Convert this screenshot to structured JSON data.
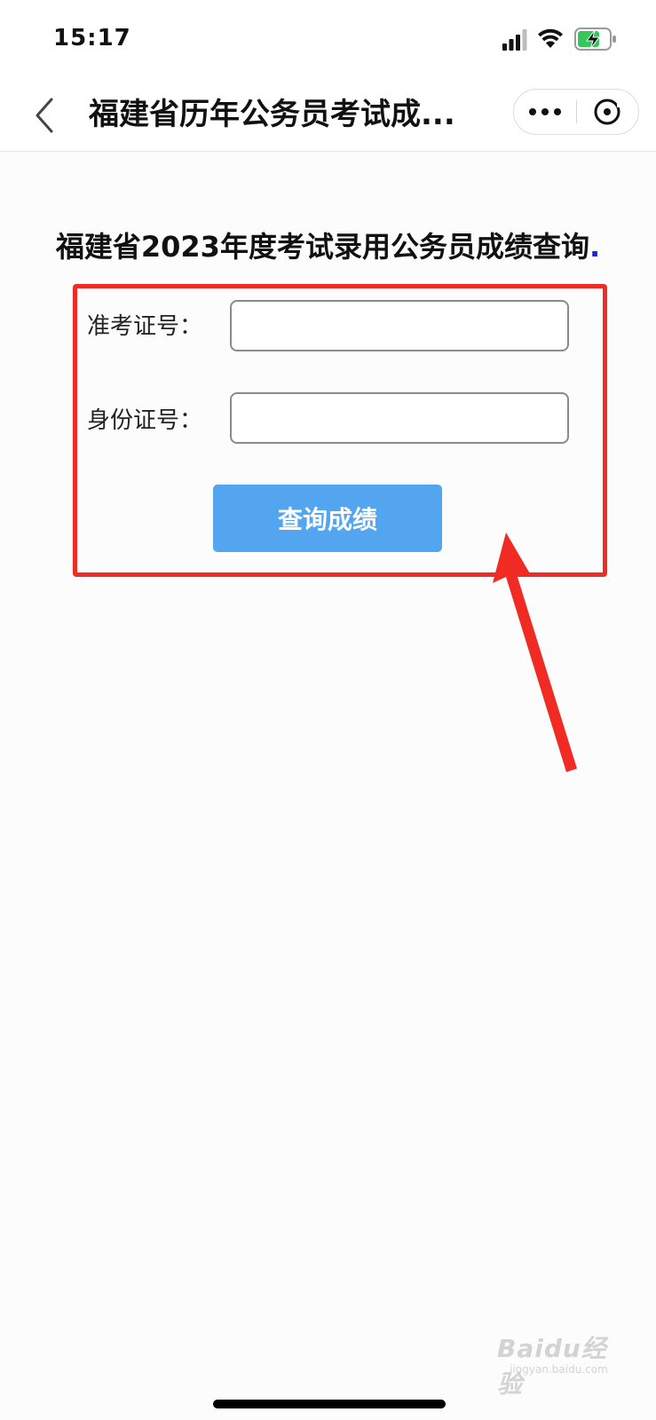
{
  "status_bar": {
    "time": "15:17",
    "icons": [
      "signal-icon",
      "wifi-icon",
      "battery-charging-icon"
    ]
  },
  "nav": {
    "title": "福建省历年公务员考试成...",
    "back_icon": "chevron-left-icon",
    "more_icon": "more-dots-icon",
    "close_icon": "close-circle-icon"
  },
  "main": {
    "heading": "福建省2023年度考试录用公务员成绩查询",
    "heading_dot": ".",
    "heading_dot_color": "#1a26d6"
  },
  "form": {
    "fields": [
      {
        "label": "准考证号：",
        "value": "",
        "placeholder": ""
      },
      {
        "label": "身份证号：",
        "value": "",
        "placeholder": ""
      }
    ],
    "submit_label": "查询成绩",
    "button_color": "#53a5f0"
  },
  "annotation": {
    "highlight_color": "#ef2b23",
    "icon": "red-arrow-icon"
  },
  "watermark": {
    "brand": "Baidu经验",
    "sub": "jingyan.baidu.com"
  }
}
